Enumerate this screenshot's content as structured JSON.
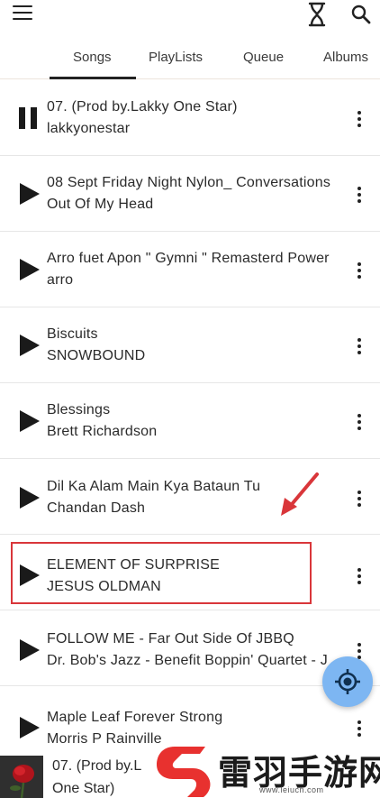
{
  "tabs": [
    {
      "label": "Songs",
      "active": true
    },
    {
      "label": "PlayLists",
      "active": false
    },
    {
      "label": "Queue",
      "active": false
    },
    {
      "label": "Albums",
      "active": false
    }
  ],
  "songs": [
    {
      "title": "07.  (Prod by.Lakky One Star)",
      "artist": "lakkyonestar",
      "state": "playing"
    },
    {
      "title": "08 Sept Friday Night Nylon_ Conversations",
      "artist": "Out Of My Head",
      "state": "paused"
    },
    {
      "title": "Arro fuet Apon \" Gymni \" Remasterd Power",
      "artist": "arro",
      "state": "paused"
    },
    {
      "title": "Biscuits",
      "artist": "SNOWBOUND",
      "state": "paused"
    },
    {
      "title": "Blessings",
      "artist": "Brett Richardson",
      "state": "paused"
    },
    {
      "title": "Dil Ka Alam Main Kya Bataun Tu",
      "artist": "Chandan Dash",
      "state": "paused"
    },
    {
      "title": "ELEMENT OF SURPRISE",
      "artist": "JESUS OLDMAN",
      "state": "paused"
    },
    {
      "title": "FOLLOW ME - Far Out Side Of JBBQ",
      "artist": "Dr. Bob's Jazz - Benefit Boppin' Quartet - J",
      "state": "paused"
    },
    {
      "title": "Maple Leaf Forever Strong",
      "artist": "Morris P Rainville",
      "state": "paused"
    }
  ],
  "now_playing": {
    "title_line1": "07.  (Prod by.L",
    "title_line2": "One Star)"
  },
  "watermark": {
    "text": "雷羽手游网",
    "url": "www.leiucn.com"
  },
  "colors": {
    "highlight": "#d9363a",
    "fab": "#7db6f2",
    "watermark_red": "#e8312f"
  }
}
